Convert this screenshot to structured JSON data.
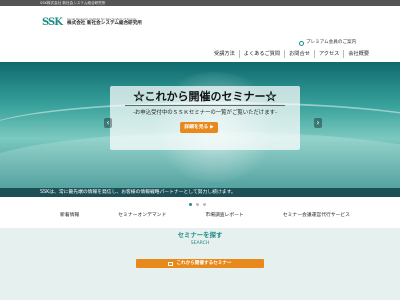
{
  "header": {
    "tagline": "SSK株式会社 新社会システム総合研究所",
    "logo_mark": "SSK",
    "logo_en": "Social Research Institute for New System of Society",
    "logo_ja": "株式会社 新社会システム総合研究所",
    "premium_label": "プレミアム会員のご案内",
    "nav": [
      "受講方法",
      "よくあるご質問",
      "お問合せ",
      "アクセス",
      "会社概要"
    ]
  },
  "hero": {
    "title": "☆これから開催のセミナー☆",
    "subtitle": "-お申込受付中のＳＳＫセミナーの一覧がご覧いただけます-",
    "button_label": "詳細を見る ▶",
    "prev_arrow": "‹",
    "next_arrow": "›"
  },
  "banner": {
    "text": "SSKは、常に最先端の情報を発信し、お客様の情報戦略パートナーとして努力し続けます。"
  },
  "slider": {
    "slide_count": 3,
    "active_index": 0
  },
  "subnav": [
    "新着情報",
    "セミナーオンデマンド",
    "市場調査レポート",
    "セミナー会議運営代行サービス"
  ],
  "search": {
    "title_ja": "セミナーを探す",
    "title_en": "SEARCH",
    "upcoming_label": "これから開催するセミナー"
  },
  "colors": {
    "accent": "#1d8c85",
    "button": "#e8891c",
    "banner": "#1d4f57"
  }
}
